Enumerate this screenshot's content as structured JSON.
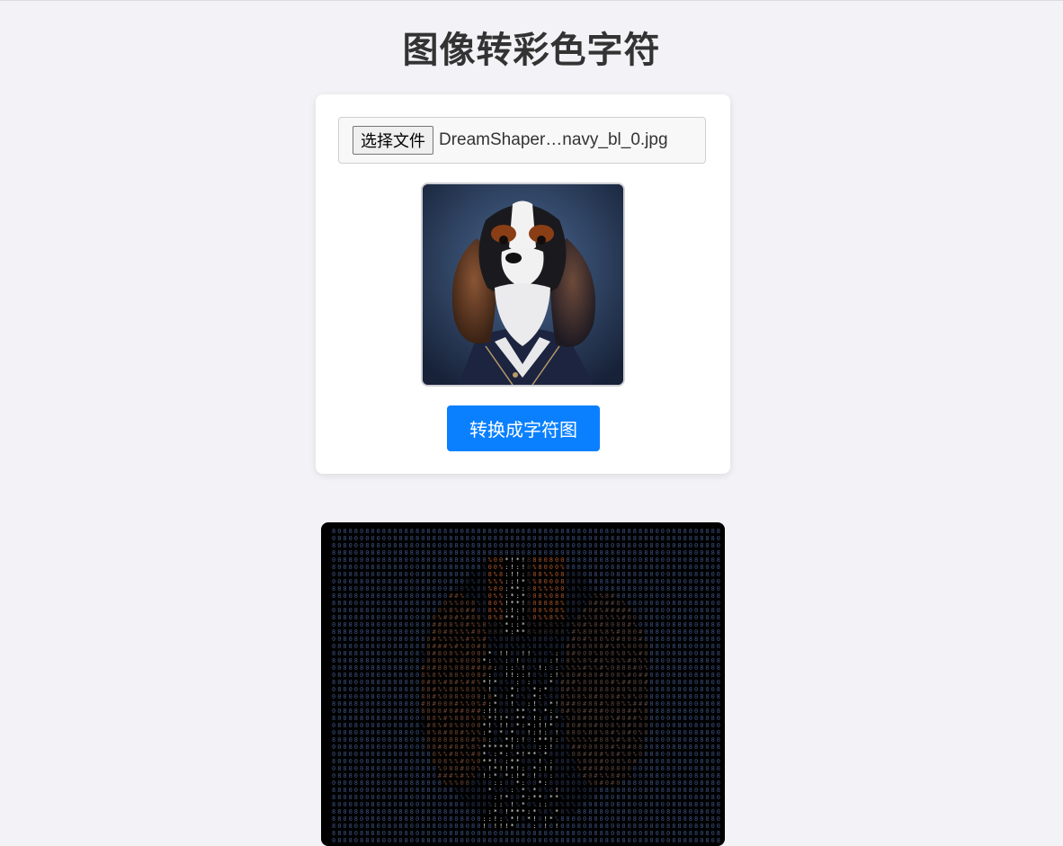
{
  "page": {
    "title": "图像转彩色字符"
  },
  "upload": {
    "choose_file_label": "选择文件",
    "file_name": "DreamShaper…navy_bl_0.jpg"
  },
  "preview": {
    "alt": "dog-portrait-preview"
  },
  "actions": {
    "convert_label": "转换成字符图"
  },
  "colors": {
    "page_background": "#f3f3f7",
    "card_background": "#ffffff",
    "accent": "#0a80ff",
    "output_background": "#000000",
    "title": "#333333"
  },
  "icons": {
    "preview": "dog-portrait-image",
    "output": "ascii-art-canvas"
  }
}
